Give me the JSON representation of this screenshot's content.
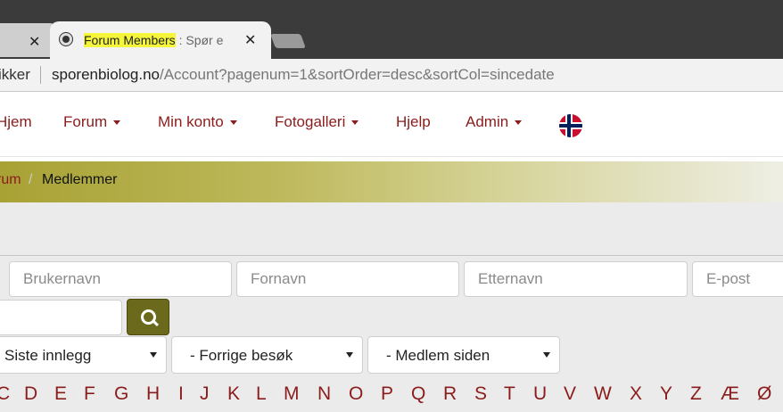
{
  "browser": {
    "tabs": [
      {
        "label": "",
        "close": "✕"
      },
      {
        "title_highlight": "Forum Members",
        "title_rest": " : Spør e",
        "close": "✕"
      }
    ],
    "address_left_label": "ikker",
    "url_host": "sporenbiolog.no",
    "url_path": "/Account?pagenum=1&sortOrder=desc&sortCol=sincedate"
  },
  "navbar": {
    "items": [
      {
        "label": "Hjem",
        "dropdown": false
      },
      {
        "label": "Forum",
        "dropdown": true
      },
      {
        "label": "Min konto",
        "dropdown": true
      },
      {
        "label": "Fotogalleri",
        "dropdown": true
      },
      {
        "label": "Hjelp",
        "dropdown": false
      },
      {
        "label": "Admin",
        "dropdown": true
      }
    ],
    "flag": "norway-flag-icon"
  },
  "breadcrumb": {
    "items": [
      "rum",
      "Medlemmer"
    ],
    "separator": "/"
  },
  "filters": {
    "username_placeholder": "Brukernavn",
    "firstname_placeholder": "Fornavn",
    "lastname_placeholder": "Etternavn",
    "email_placeholder": "E-post",
    "search_value": "",
    "sort_select": "Siste innlegg",
    "last_visit_select": "- Forrige besøk",
    "member_since_select": "- Medlem siden"
  },
  "alphabet": [
    "C",
    "D",
    "E",
    "F",
    "G",
    "H",
    "I",
    "J",
    "K",
    "L",
    "M",
    "N",
    "O",
    "P",
    "Q",
    "R",
    "S",
    "T",
    "U",
    "V",
    "W",
    "X",
    "Y",
    "Z",
    "Æ",
    "Ø"
  ],
  "colors": {
    "link": "#8b1c1c",
    "search_button": "#6b6a1c",
    "breadcrumb_start": "#a8a235"
  }
}
